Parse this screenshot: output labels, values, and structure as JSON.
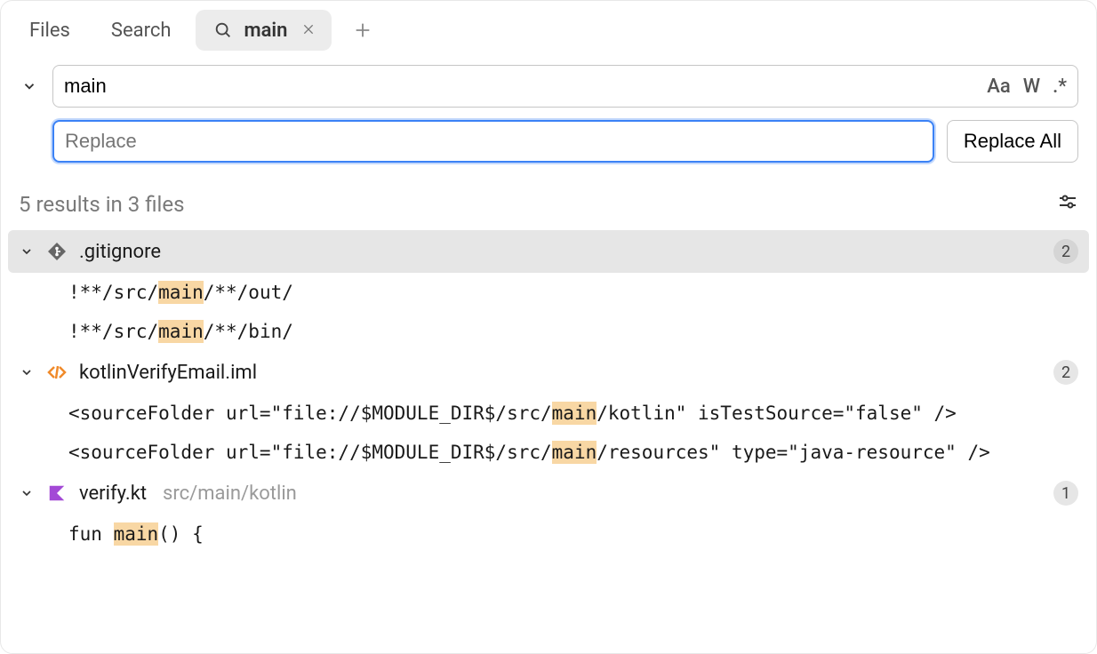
{
  "tabs": {
    "files": "Files",
    "search": "Search",
    "active": {
      "label": "main"
    }
  },
  "search": {
    "query": "main",
    "case_label": "Aa",
    "word_label": "W",
    "regex_label": ".*",
    "replace_placeholder": "Replace",
    "replace_value": "",
    "replace_all_label": "Replace All"
  },
  "results": {
    "summary": "5 results in 3 files",
    "highlight": "main"
  },
  "files": [
    {
      "name": ".gitignore",
      "icon": "git",
      "count": "2",
      "selected": true,
      "matches": [
        {
          "pre": "!**/src/",
          "hit": "main",
          "post": "/**/out/"
        },
        {
          "pre": "!**/src/",
          "hit": "main",
          "post": "/**/bin/"
        }
      ]
    },
    {
      "name": "kotlinVerifyEmail.iml",
      "icon": "iml",
      "count": "2",
      "selected": false,
      "matches": [
        {
          "pre": "<sourceFolder url=\"file://$MODULE_DIR$/src/",
          "hit": "main",
          "post": "/kotlin\" isTestSource=\"false\" />"
        },
        {
          "pre": "<sourceFolder url=\"file://$MODULE_DIR$/src/",
          "hit": "main",
          "post": "/resources\" type=\"java-resource\" />"
        }
      ]
    },
    {
      "name": "verify.kt",
      "path": "src/main/kotlin",
      "icon": "kt",
      "count": "1",
      "selected": false,
      "matches": [
        {
          "pre": "fun ",
          "hit": "main",
          "post": "() {"
        }
      ]
    }
  ]
}
